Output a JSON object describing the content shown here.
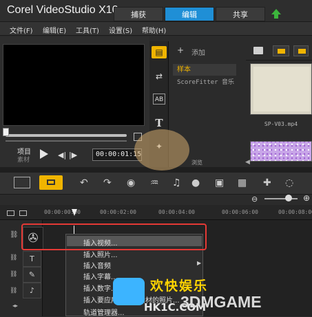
{
  "app": {
    "title": "Corel VideoStudio X10"
  },
  "tabs": [
    {
      "label": "捕获",
      "active": false
    },
    {
      "label": "编辑",
      "active": true
    },
    {
      "label": "共享",
      "active": false
    }
  ],
  "menu": [
    "文件(F)",
    "编辑(E)",
    "工具(T)",
    "设置(S)",
    "帮助(H)"
  ],
  "preview": {
    "mode_project": "项目",
    "mode_clip": "素材",
    "timecode": "00:00:01:15"
  },
  "library": {
    "add_label": "添加",
    "nav": {
      "selected": "样本",
      "scorefitter": "ScoreFitter 音乐"
    },
    "browse": "浏览",
    "thumb_caption": "SP-V03.mp4"
  },
  "timeline": {
    "ruler": [
      "00:00:00:00",
      "00:00:02:00",
      "00:00:04:00",
      "00:00:06:00",
      "00:00:08:00"
    ]
  },
  "context_menu": [
    "插入视频...",
    "插入照片...",
    "插入音频",
    "插入字幕...",
    "插入数字...",
    "插入要应用于当前素材的照片...",
    "轨道管理器..."
  ],
  "watermark": {
    "cn": "欢快娱乐",
    "site": "3DMGAME",
    "url": "HK1C.COM"
  },
  "colors": {
    "accent": "#1f8fd6",
    "library_accent": "#f0b400",
    "highlight": "#e53935"
  }
}
